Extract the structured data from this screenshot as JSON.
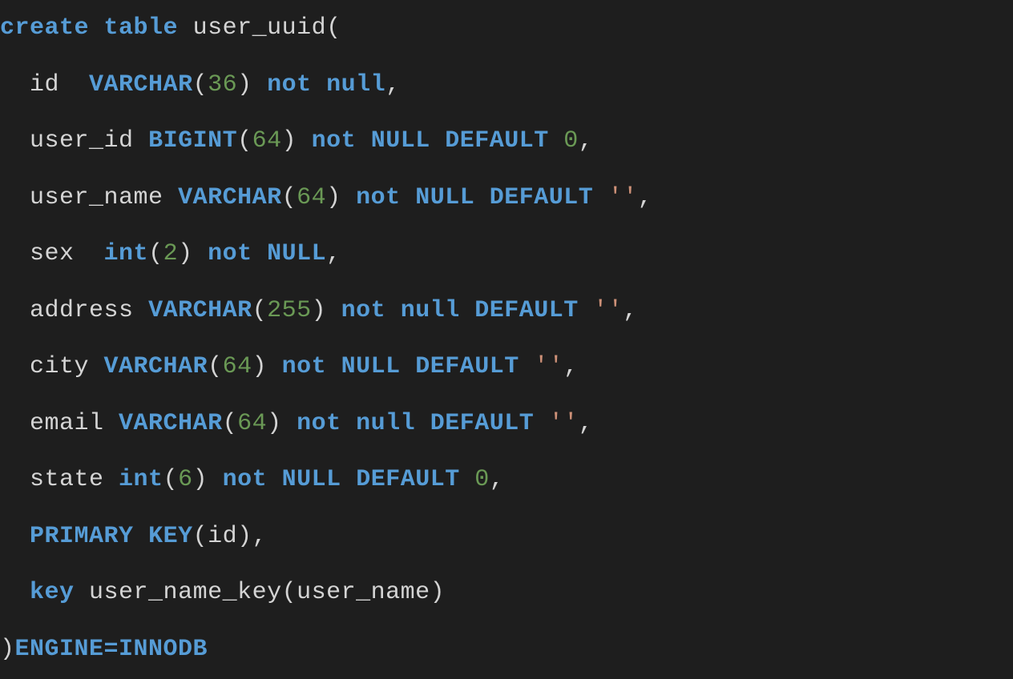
{
  "code": {
    "line1": {
      "create": "create",
      "table": "table",
      "name": "user_uuid",
      "open": "("
    },
    "line2": {
      "col": "id",
      "type": "VARCHAR",
      "lparen": "(",
      "size": "36",
      "rparen": ")",
      "not": "not",
      "null": "null",
      "comma": ","
    },
    "line3": {
      "col": "user_id",
      "type": "BIGINT",
      "lparen": "(",
      "size": "64",
      "rparen": ")",
      "not": "not",
      "null": "NULL",
      "default": "DEFAULT",
      "val": "0",
      "comma": ","
    },
    "line4": {
      "col": "user_name",
      "type": "VARCHAR",
      "lparen": "(",
      "size": "64",
      "rparen": ")",
      "not": "not",
      "null": "NULL",
      "default": "DEFAULT",
      "val": "''",
      "comma": ","
    },
    "line5": {
      "col": "sex",
      "type": "int",
      "lparen": "(",
      "size": "2",
      "rparen": ")",
      "not": "not",
      "null": "NULL",
      "comma": ","
    },
    "line6": {
      "col": "address",
      "type": "VARCHAR",
      "lparen": "(",
      "size": "255",
      "rparen": ")",
      "not": "not",
      "null": "null",
      "default": "DEFAULT",
      "val": "''",
      "comma": ","
    },
    "line7": {
      "col": "city",
      "type": "VARCHAR",
      "lparen": "(",
      "size": "64",
      "rparen": ")",
      "not": "not",
      "null": "NULL",
      "default": "DEFAULT",
      "val": "''",
      "comma": ","
    },
    "line8": {
      "col": "email",
      "type": "VARCHAR",
      "lparen": "(",
      "size": "64",
      "rparen": ")",
      "not": "not",
      "null": "null",
      "default": "DEFAULT",
      "val": "''",
      "comma": ","
    },
    "line9": {
      "col": "state",
      "type": "int",
      "lparen": "(",
      "size": "6",
      "rparen": ")",
      "not": "not",
      "null": "NULL",
      "default": "DEFAULT",
      "val": "0",
      "comma": ","
    },
    "line10": {
      "primary": "PRIMARY",
      "key": "KEY",
      "lparen": "(",
      "col": "id",
      "rparen": ")",
      "comma": ","
    },
    "line11": {
      "key": "key",
      "name": "user_name_key",
      "lparen": "(",
      "col": "user_name",
      "rparen": ")"
    },
    "line12": {
      "close": ")",
      "engine": "ENGINE=INNODB"
    }
  }
}
